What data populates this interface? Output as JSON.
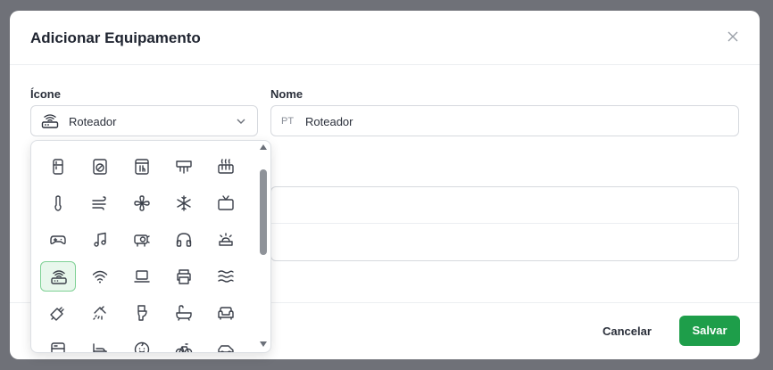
{
  "modal": {
    "title": "Adicionar Equipamento"
  },
  "form": {
    "icon_label": "Ícone",
    "icon_selected": "Roteador",
    "name_label": "Nome",
    "name_prefix": "PT",
    "name_value": "Roteador"
  },
  "footer": {
    "cancel_label": "Cancelar",
    "save_label": "Salvar"
  },
  "colors": {
    "accent": "#1e9e4a",
    "selected_bg": "#e8f7ec"
  },
  "icon_grid": [
    [
      "fridge-icon",
      "washing-machine-icon",
      "oven-icon",
      "air-conditioner-icon",
      "heater-icon"
    ],
    [
      "thermometer-icon",
      "wind-icon",
      "fan-icon",
      "snowflake-icon",
      "tv-icon"
    ],
    [
      "gamepad-icon",
      "music-icon",
      "projector-icon",
      "headphones-icon",
      "alarm-icon"
    ],
    [
      "router-icon",
      "wifi-icon",
      "laptop-icon",
      "printer-icon",
      "waves-icon"
    ],
    [
      "plug-icon",
      "shower-icon",
      "toilet-icon",
      "bathtub-icon",
      "sofa-icon"
    ],
    [
      "bed-top-icon",
      "bed-icon",
      "baby-icon",
      "bicycle-icon",
      "car-icon"
    ]
  ],
  "selected_icon": "router-icon"
}
